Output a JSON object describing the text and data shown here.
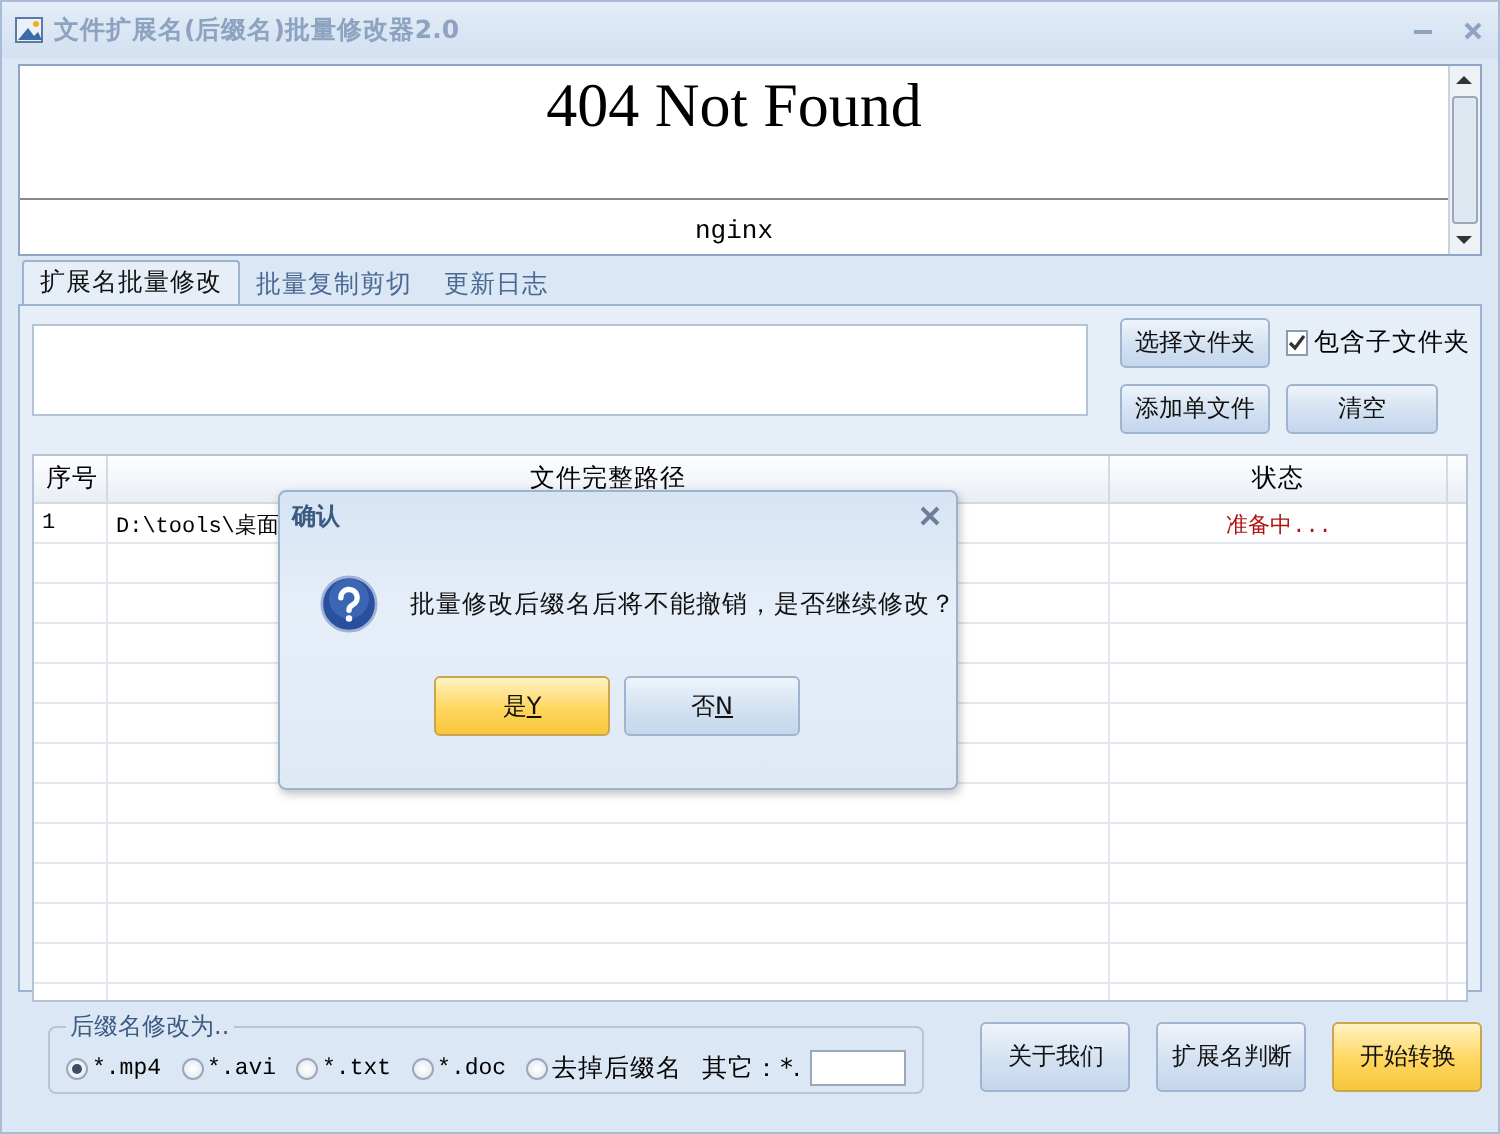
{
  "window": {
    "title": "文件扩展名(后缀名)批量修改器2.0"
  },
  "web_panel": {
    "heading": "404 Not Found",
    "footer": "nginx"
  },
  "tabs": [
    {
      "label": "扩展名批量修改",
      "selected": true
    },
    {
      "label": "批量复制剪切",
      "selected": false
    },
    {
      "label": "更新日志",
      "selected": false
    }
  ],
  "folder_buttons": [
    {
      "label": "选择文件夹"
    },
    {
      "label": "添加单文件"
    },
    {
      "label": "清空"
    }
  ],
  "include_subfolders": {
    "label": "包含子文件夹",
    "checked": true
  },
  "table": {
    "columns": [
      "序号",
      "文件完整路径",
      "状态"
    ],
    "rows": [
      {
        "index": "1",
        "path": "D:\\tools\\桌面",
        "status": "准备中..."
      }
    ]
  },
  "suffix_group": {
    "legend": "后缀名修改为..",
    "other_label": "其它：*.",
    "options": [
      {
        "label": "*.mp4",
        "selected": true
      },
      {
        "label": "*.avi",
        "selected": false
      },
      {
        "label": "*.txt",
        "selected": false
      },
      {
        "label": "*.doc",
        "selected": false
      },
      {
        "label": "去掉后缀名",
        "selected": false
      }
    ]
  },
  "actions": [
    {
      "label": "关于我们",
      "focused": false
    },
    {
      "label": "扩展名判断",
      "focused": false
    },
    {
      "label": "开始转换",
      "focused": true
    }
  ],
  "dialog": {
    "title": "确认",
    "message": "批量修改后缀名后将不能撤销，是否继续修改？",
    "buttons": [
      {
        "label": "是",
        "accelerator": "Y",
        "focused": true
      },
      {
        "label": "否",
        "accelerator": "N",
        "focused": false
      }
    ]
  }
}
